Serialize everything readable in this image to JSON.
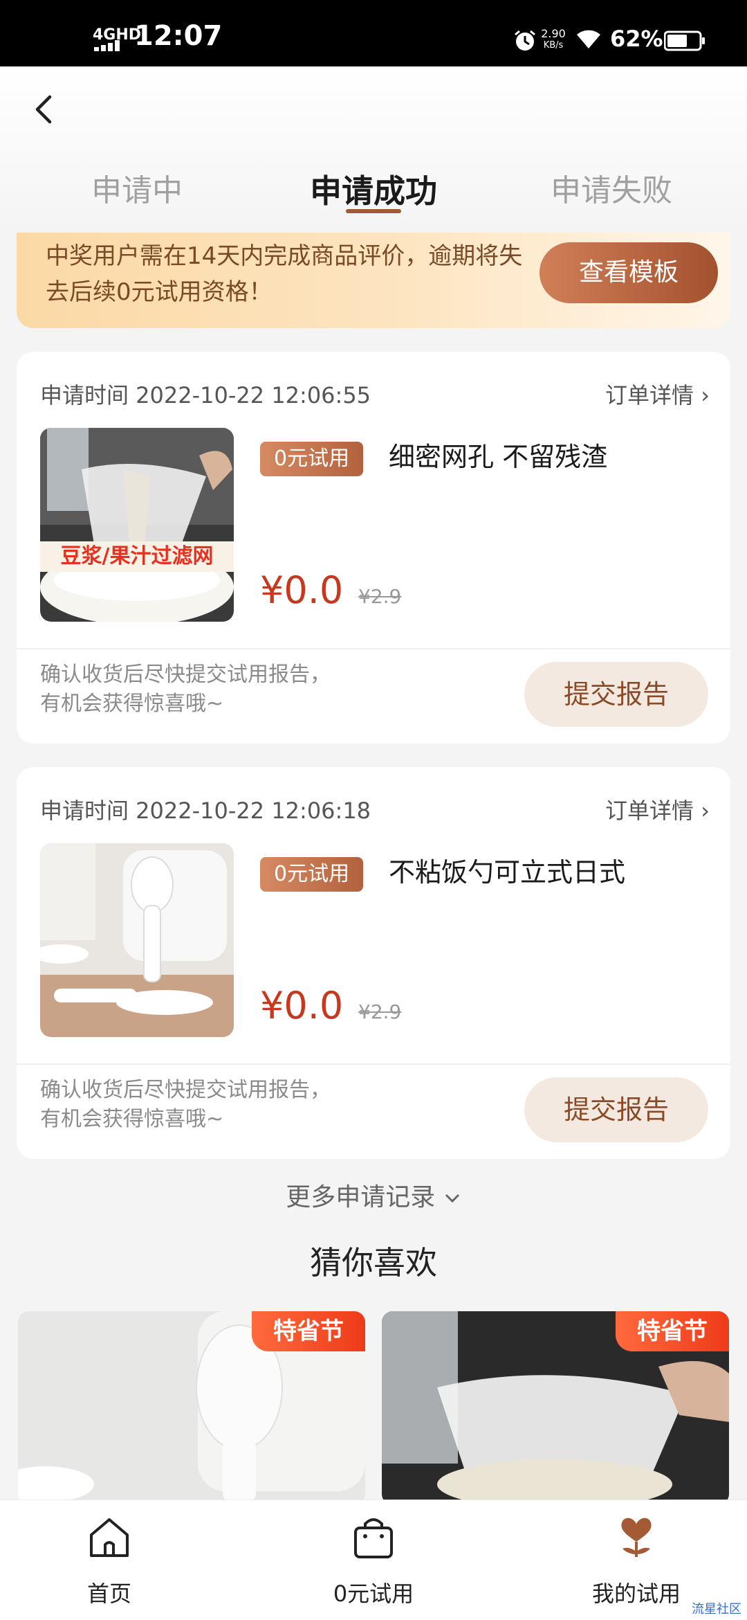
{
  "status_bar": {
    "network": "4GHD",
    "time": "12:07",
    "speed_value": "2.90",
    "speed_unit": "KB/s",
    "battery": "62%"
  },
  "tabs": [
    {
      "label": "申请中",
      "active": false
    },
    {
      "label": "申请成功",
      "active": true
    },
    {
      "label": "申请失败",
      "active": false
    }
  ],
  "notice": {
    "text": "中奖用户需在14天内完成商品评价，逾期将失去后续0元试用资格！",
    "button": "查看模板"
  },
  "orders": [
    {
      "time": "申请时间 2022-10-22 12:06:55",
      "detail_link": "订单详情 ›",
      "tag": "0元试用",
      "title": "细密网孔 不留残渣",
      "image_caption": "豆浆/果汁过滤网",
      "price": "¥0.0",
      "original_price": "¥2.9",
      "hint": "确认收货后尽快提交试用报告，有机会获得惊喜哦~",
      "button": "提交报告"
    },
    {
      "time": "申请时间 2022-10-22 12:06:18",
      "detail_link": "订单详情 ›",
      "tag": "0元试用",
      "title": "不粘饭勺可立式日式",
      "price": "¥0.0",
      "original_price": "¥2.9",
      "hint": "确认收货后尽快提交试用报告，有机会获得惊喜哦~",
      "button": "提交报告"
    }
  ],
  "more_records": "更多申请记录",
  "guess_title": "猜你喜欢",
  "recommendations": [
    {
      "badge": "特省节"
    },
    {
      "badge": "特省节"
    }
  ],
  "bottom_nav": [
    {
      "label": "首页",
      "icon": "home-icon"
    },
    {
      "label": "0元试用",
      "icon": "shopping-bag-icon"
    },
    {
      "label": "我的试用",
      "icon": "flower-icon"
    }
  ],
  "watermark": "流星社区",
  "colors": {
    "accent_brown": "#a35a35",
    "price_red": "#c8381f",
    "badge_red": "#ee3b1a",
    "notice_bg": "#fde5c1"
  }
}
